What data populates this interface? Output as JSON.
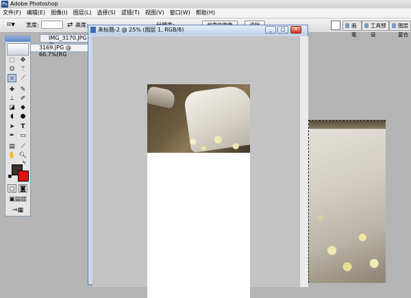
{
  "app": {
    "title": "Adobe Photoshop"
  },
  "menu": [
    "文件(F)",
    "编辑(E)",
    "图像(I)",
    "图层(L)",
    "选择(S)",
    "滤镜(T)",
    "视图(V)",
    "窗口(W)",
    "帮助(H)"
  ],
  "options": {
    "width_label": "宽度:",
    "height_label": "高度:",
    "resolution_label": "分辨率:",
    "front_image_button": "前面的图像",
    "clear_button": "清除",
    "crop_icon": "crop-icon"
  },
  "palettes": {
    "brushes_tab": "画笔",
    "tool_presets_tab": "工具预设",
    "layer_comps_tab": "图层复合"
  },
  "documents": {
    "doc1_tab": "IMG_3170.JPG @",
    "doc2_tab": "3169.JPG @ 66.7%(RG",
    "main_title": "未标题-2 @ 25% (图层 1, RGB/8)"
  },
  "colors": {
    "foreground": "#3e2f28",
    "background": "#e01010",
    "window_frame": "#5b7fb5"
  }
}
